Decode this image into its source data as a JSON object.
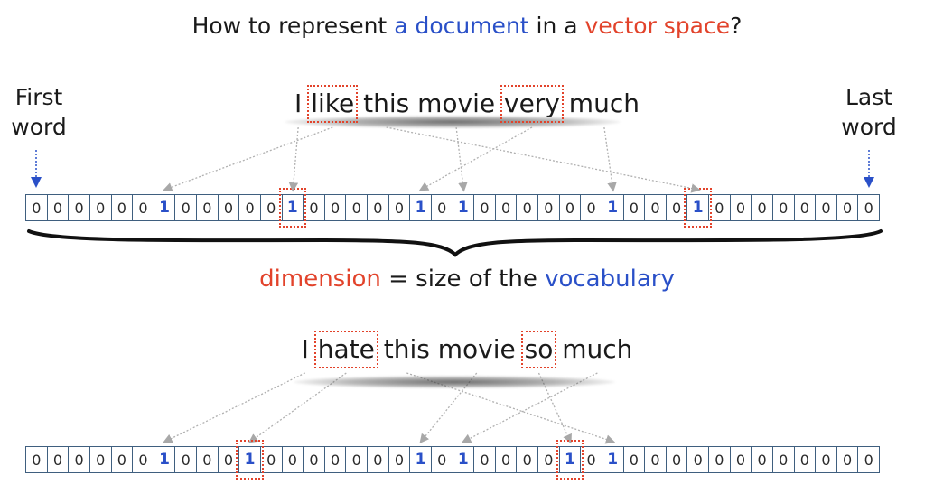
{
  "title": {
    "pre": "How to represent ",
    "highlight1": "a document",
    "mid": " in a ",
    "highlight2": "vector space",
    "post": "?"
  },
  "first_word_label": [
    "First",
    "word"
  ],
  "last_word_label": [
    "Last",
    "word"
  ],
  "sentence1": [
    {
      "text": "I",
      "boxed": false
    },
    {
      "text": "like",
      "boxed": true
    },
    {
      "text": "this",
      "boxed": false
    },
    {
      "text": "movie",
      "boxed": false
    },
    {
      "text": "very",
      "boxed": true
    },
    {
      "text": "much",
      "boxed": false
    }
  ],
  "sentence2": [
    {
      "text": "I",
      "boxed": false
    },
    {
      "text": "hate",
      "boxed": true
    },
    {
      "text": "this",
      "boxed": false
    },
    {
      "text": "movie",
      "boxed": false
    },
    {
      "text": "so",
      "boxed": true
    },
    {
      "text": "much",
      "boxed": false
    }
  ],
  "vector1": [
    "0",
    "0",
    "0",
    "0",
    "0",
    "0",
    "1",
    "0",
    "0",
    "0",
    "0",
    "0",
    "1",
    "0",
    "0",
    "0",
    "0",
    "0",
    "1",
    "0",
    "1",
    "0",
    "0",
    "0",
    "0",
    "0",
    "0",
    "1",
    "0",
    "0",
    "0",
    "1",
    "0",
    "0",
    "0",
    "0",
    "0",
    "0",
    "0",
    "0"
  ],
  "vector1_boxed": [
    12,
    31
  ],
  "vector1_links": [
    [
      0,
      12
    ],
    [
      1,
      6
    ],
    [
      2,
      31
    ],
    [
      3,
      20
    ],
    [
      4,
      18
    ],
    [
      5,
      27
    ]
  ],
  "vector2": [
    "0",
    "0",
    "0",
    "0",
    "0",
    "0",
    "1",
    "0",
    "0",
    "0",
    "1",
    "0",
    "0",
    "0",
    "0",
    "0",
    "0",
    "0",
    "1",
    "0",
    "1",
    "0",
    "0",
    "0",
    "0",
    "1",
    "0",
    "1",
    "0",
    "0",
    "0",
    "0",
    "0",
    "0",
    "0",
    "0",
    "0",
    "0",
    "0",
    "0"
  ],
  "vector2_boxed": [
    10,
    25
  ],
  "vector2_links": [
    [
      0,
      6
    ],
    [
      1,
      10
    ],
    [
      2,
      27
    ],
    [
      3,
      18
    ],
    [
      4,
      25
    ],
    [
      5,
      20
    ]
  ],
  "dimension": {
    "word1": "dimension",
    "mid": " = size of the ",
    "word2": "vocabulary"
  }
}
